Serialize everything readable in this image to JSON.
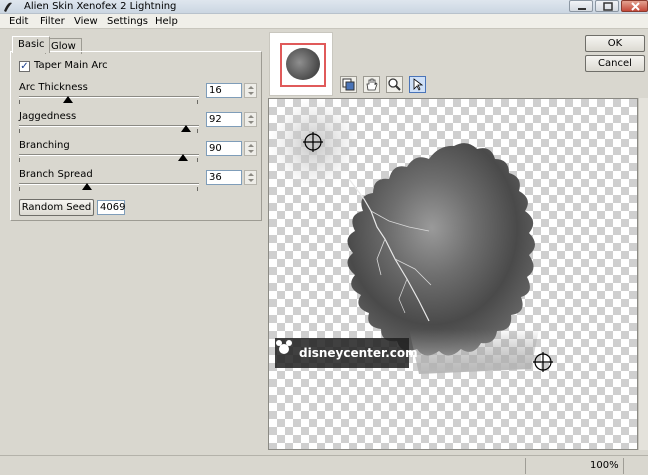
{
  "window": {
    "title": "Alien Skin Xenofex 2 Lightning"
  },
  "menu": [
    "Edit",
    "Filter",
    "View",
    "Settings",
    "Help"
  ],
  "tabs": [
    "Basic",
    "Glow"
  ],
  "taper": {
    "label": "Taper Main Arc",
    "checked": true,
    "mark": "✓"
  },
  "params": [
    {
      "label": "Arc Thickness",
      "value": "16",
      "fraction": 0.27
    },
    {
      "label": "Jaggedness",
      "value": "92",
      "fraction": 0.93
    },
    {
      "label": "Branching",
      "value": "90",
      "fraction": 0.91
    },
    {
      "label": "Branch Spread",
      "value": "36",
      "fraction": 0.38
    }
  ],
  "seed": {
    "button_label": "Random Seed",
    "value": "4069"
  },
  "buttons": {
    "ok": "OK",
    "cancel": "Cancel"
  },
  "tools": [
    "compare-icon",
    "hand-icon",
    "zoom-icon",
    "pointer-icon"
  ],
  "watermark": "disneycenter.com",
  "status": {
    "zoom": "100%"
  },
  "colors": {
    "thumbnail_frame": "#e05a5a",
    "selected_tool": "#cfe0f7"
  }
}
